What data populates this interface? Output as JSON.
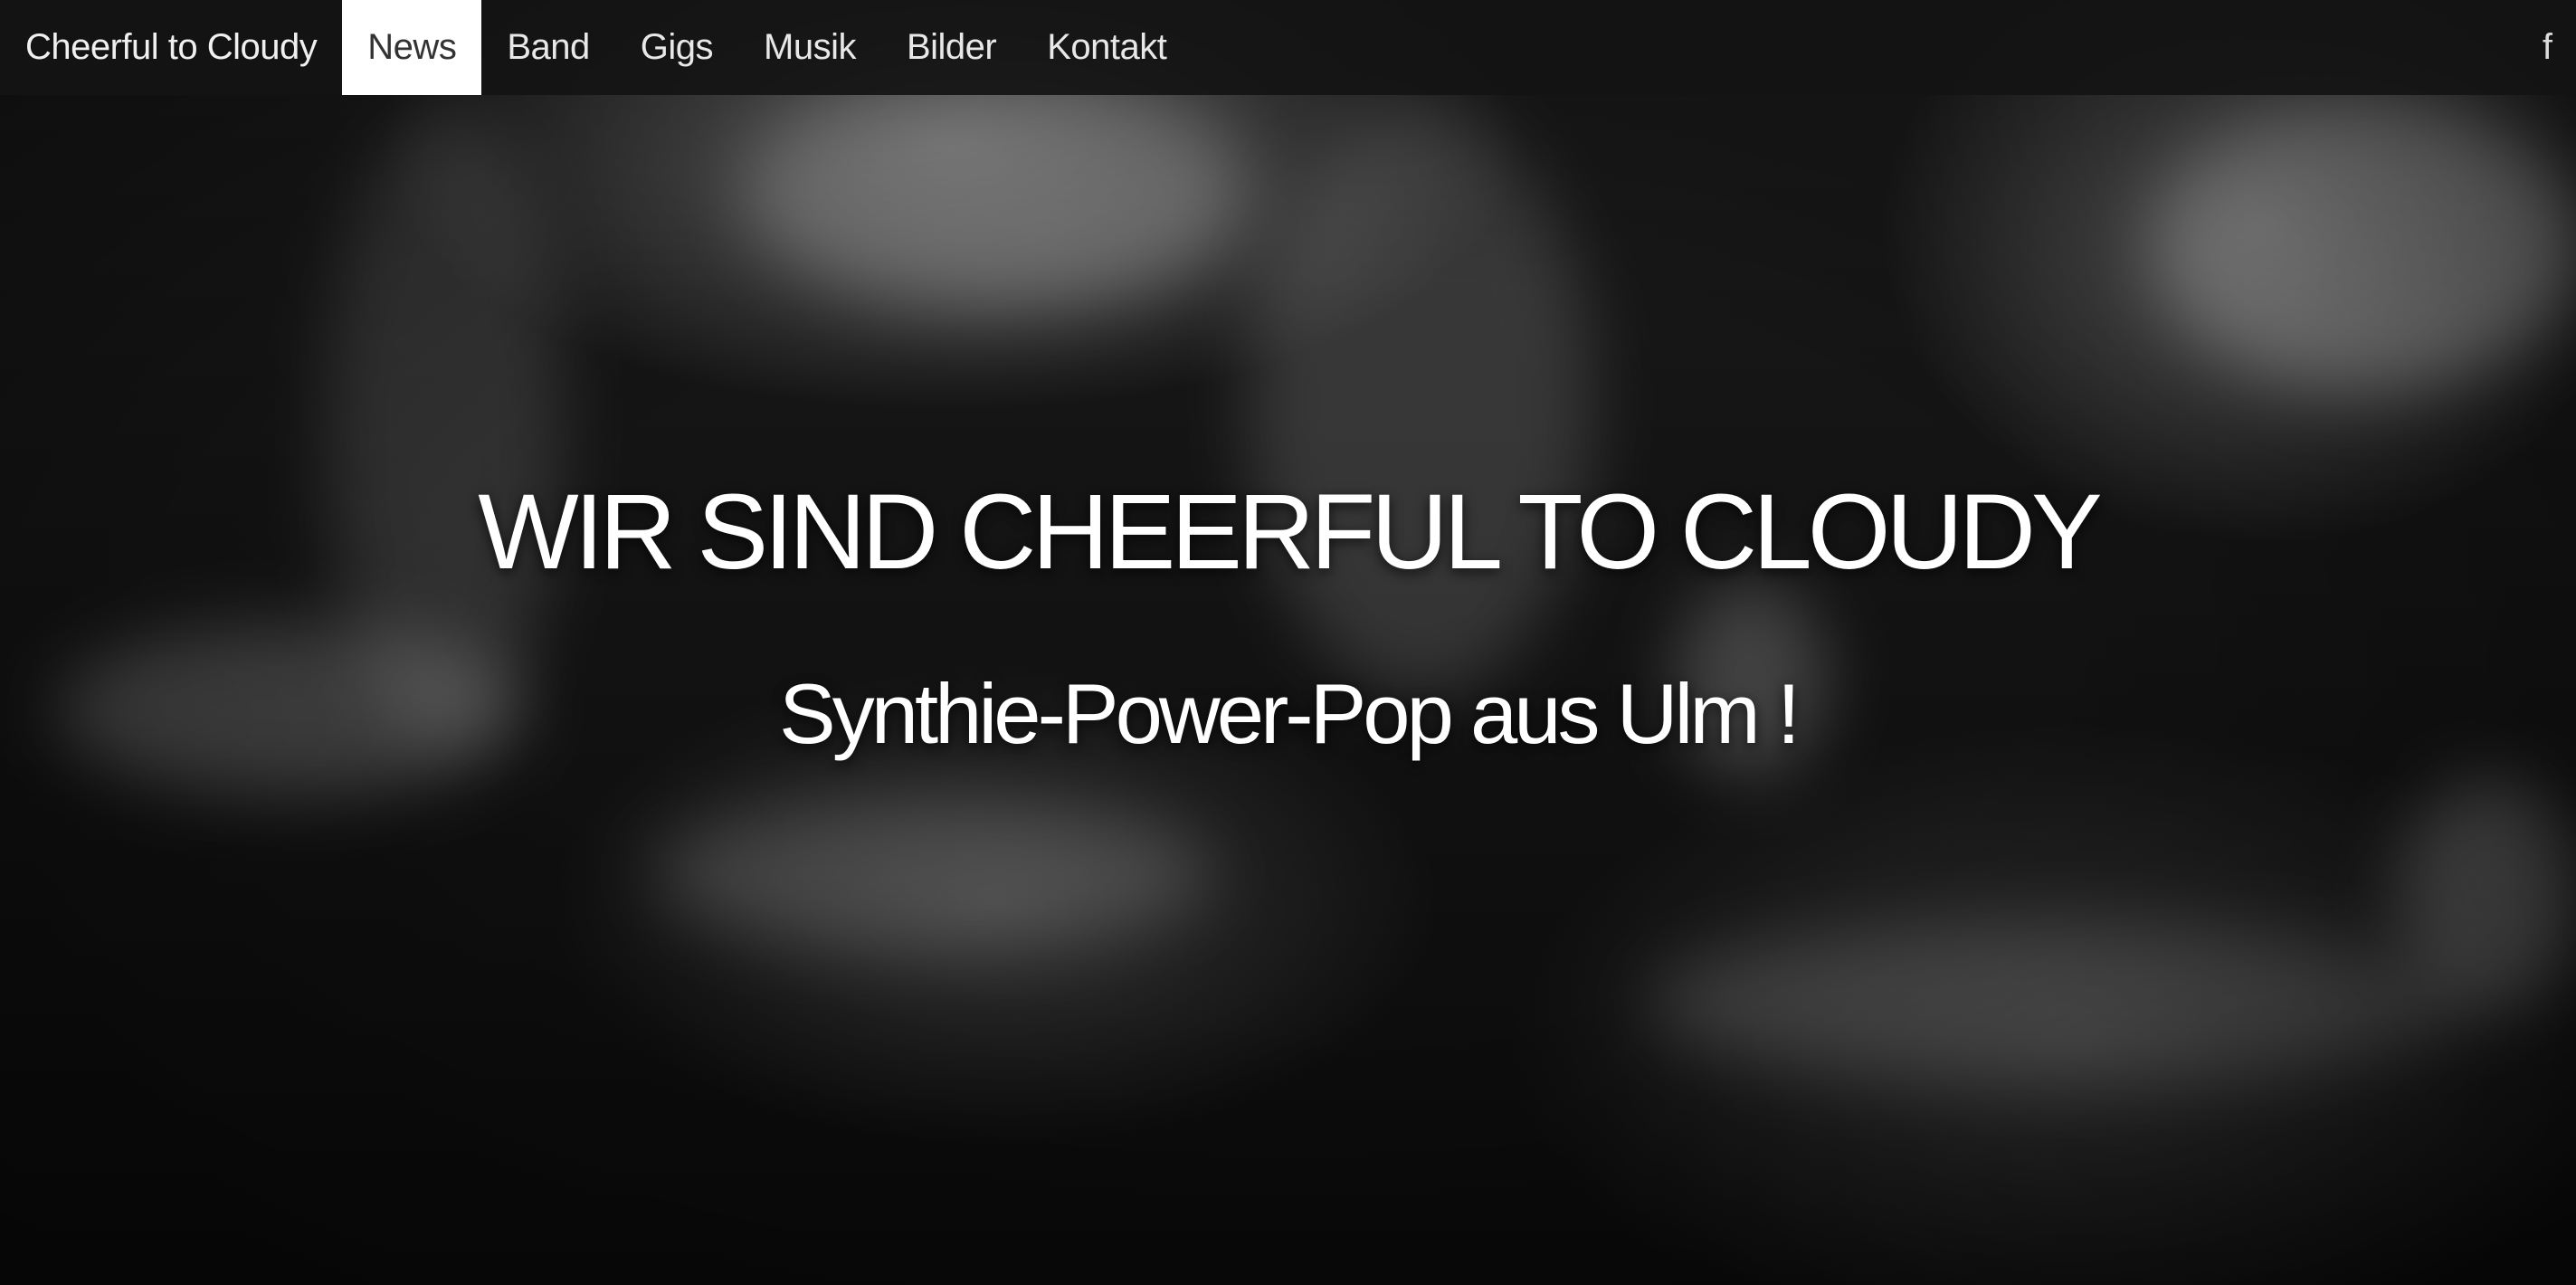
{
  "navbar": {
    "brand": "Cheerful to Cloudy",
    "items": [
      {
        "label": "News",
        "active": true
      },
      {
        "label": "Band",
        "active": false
      },
      {
        "label": "Gigs",
        "active": false
      },
      {
        "label": "Musik",
        "active": false
      },
      {
        "label": "Bilder",
        "active": false
      },
      {
        "label": "Kontakt",
        "active": false
      }
    ],
    "social_icon": "facebook-icon",
    "social_glyph": "f"
  },
  "hero": {
    "title": "WIR SIND CHEERFUL TO CLOUDY",
    "subtitle": "Synthie-Power-Pop aus Ulm !"
  },
  "colors": {
    "navbar_bg": "#141414",
    "active_tab_bg": "#ffffff",
    "text": "#ffffff"
  }
}
